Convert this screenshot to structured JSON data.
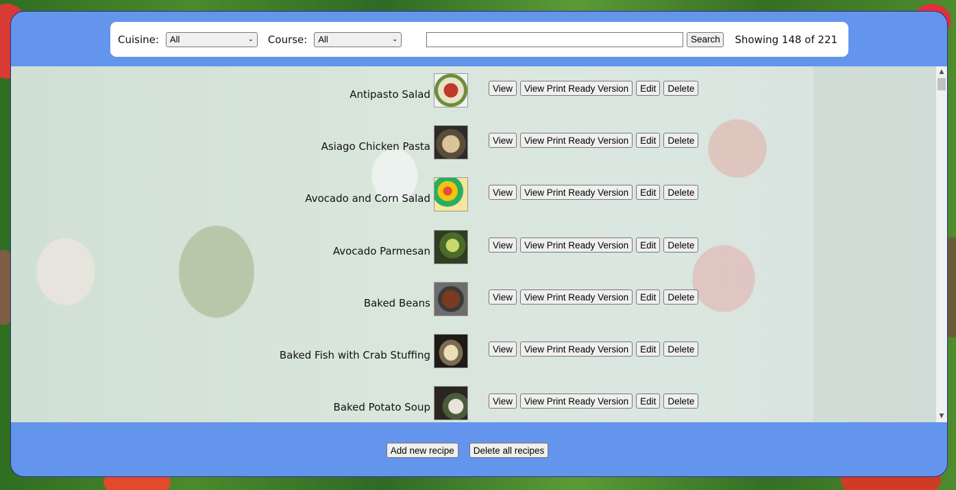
{
  "toolbar": {
    "cuisine_label": "Cuisine:",
    "cuisine_value": "All",
    "course_label": "Course:",
    "course_value": "All",
    "search_value": "",
    "search_button": "Search",
    "showing_text": "Showing 148 of 221"
  },
  "recipes": [
    {
      "name": "Antipasto Salad"
    },
    {
      "name": "Asiago Chicken Pasta"
    },
    {
      "name": "Avocado and Corn Salad"
    },
    {
      "name": "Avocado Parmesan"
    },
    {
      "name": "Baked Beans"
    },
    {
      "name": "Baked Fish with Crab Stuffing"
    },
    {
      "name": "Baked Potato Soup"
    }
  ],
  "row_actions": {
    "view": "View",
    "print": "View Print Ready Version",
    "edit": "Edit",
    "delete": "Delete"
  },
  "footer": {
    "add_button": "Add new recipe",
    "delete_all_button": "Delete all recipes"
  },
  "colors": {
    "panel": "#6495ed",
    "toolbar_bg": "#ffffff"
  }
}
